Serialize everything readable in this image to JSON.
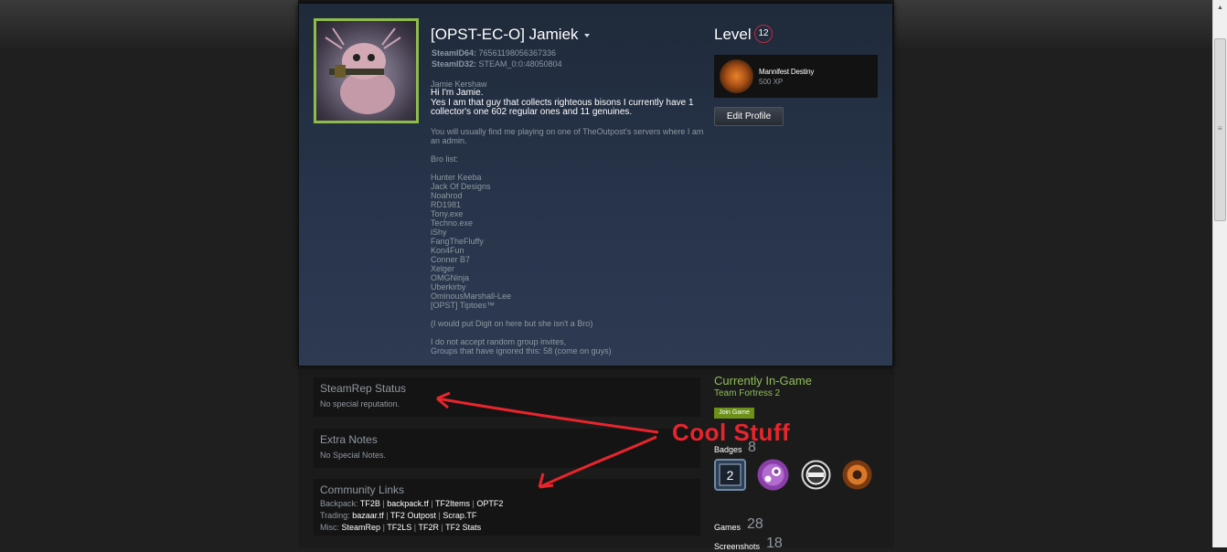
{
  "profile": {
    "name": "[OPST-EC-O] Jamiek",
    "steamid64_label": "SteamID64:",
    "steamid64_value": "76561198056367336",
    "steamid32_label": "SteamID32:",
    "steamid32_value": "STEAM_0:0:48050804",
    "summary": {
      "real_name": "Jamie Kershaw",
      "intro": "Hi I'm Jamie.",
      "intro2": "Yes I am that guy that collects righteous bisons I currently have 1 collector's one 602 regular ones and 11 genuines.",
      "play": "You will usually find me playing on one of TheOutpost's servers where I am an admin.",
      "bro_header": "Bro list:",
      "bros": [
        "Hunter Keeba",
        "Jack Of Designs",
        "Noahrod",
        "RD1981",
        "Tony.exe",
        "Techno.exe",
        "iShy",
        "FangTheFluffy",
        "Kon4Fun",
        "Conner B7",
        "Xelger",
        "OMGNinja",
        "Uberkirby",
        "OminousMarshall-Lee",
        "[OPST] Tiptoes™"
      ],
      "digit": "(I would put Digit on here but she isn't a Bro)",
      "invites1": "I do not accept random group invites,",
      "invites2": "Groups that have ignored this: 58 (come on guys)"
    }
  },
  "level": {
    "label": "Level",
    "value": "12",
    "badge_name": "Mannifest Destiny",
    "badge_xp": "500 XP",
    "edit_button": "Edit Profile"
  },
  "sections": {
    "steamrep_title": "SteamRep Status",
    "steamrep_text": "No special reputation.",
    "notes_title": "Extra Notes",
    "notes_text": "No Special Notes.",
    "links_title": "Community Links",
    "backpack_label": "Backpack:",
    "backpack_links": [
      "TF2B",
      "backpack.tf",
      "TF2Items",
      "OPTF2"
    ],
    "trading_label": "Trading:",
    "trading_links": [
      "bazaar.tf",
      "TF2 Outpost",
      "Scrap.TF"
    ],
    "misc_label": "Misc:",
    "misc_links": [
      "SteamRep",
      "TF2LS",
      "TF2R",
      "TF2 Stats"
    ],
    "separator": "|"
  },
  "sidebar": {
    "ingame_title": "Currently In-Game",
    "ingame_game": "Team Fortress 2",
    "join_button": "Join Game",
    "badges_label": "Badges",
    "badges_count": "8",
    "badge_icon_text": "2",
    "games_label": "Games",
    "games_count": "28",
    "screenshots_label": "Screenshots",
    "screenshots_count": "18"
  },
  "annotation": {
    "text": "Cool Stuff",
    "color": "#e8242c"
  },
  "colors": {
    "ingame_green": "#8ebe56",
    "avatar_border": "#8ebc4b",
    "level_ring": "#c02942"
  }
}
